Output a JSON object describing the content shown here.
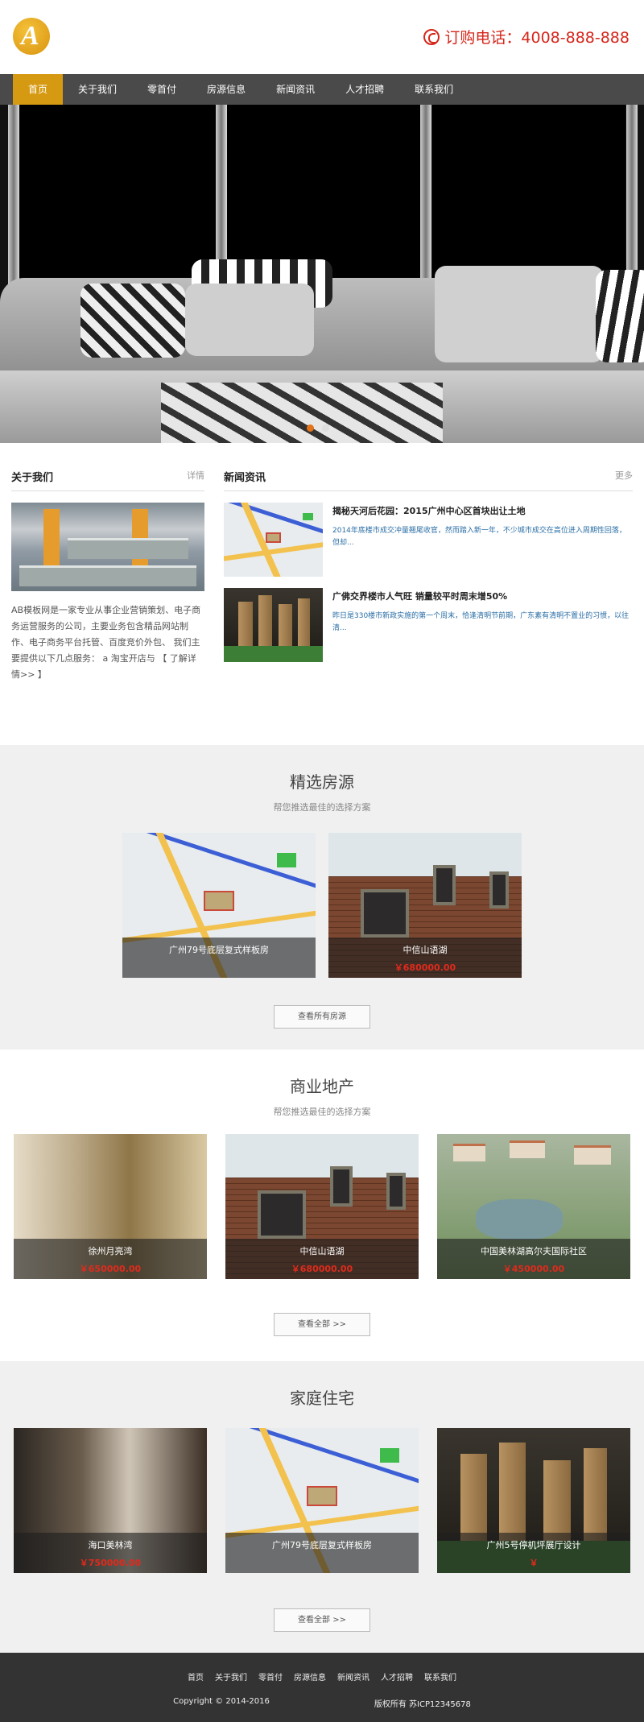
{
  "header": {
    "logo_letter": "A",
    "hotline": "订购电话：4008-888-888"
  },
  "nav": [
    "首页",
    "关于我们",
    "零首付",
    "房源信息",
    "新闻资讯",
    "人才招聘",
    "联系我们"
  ],
  "about": {
    "title": "关于我们",
    "more": "详情",
    "text": "AB模板网是一家专业从事企业营销策划、电子商务运营服务的公司，主要业务包含精品网站制作、电子商务平台托管、百度竞价外包、 我们主要提供以下几点服务： a 淘宝开店与 【 了解详情>> 】"
  },
  "news": {
    "title": "新闻资讯",
    "more": "更多",
    "items": [
      {
        "title": "揭秘天河后花园：2015广州中心区首块出让土地",
        "desc": "2014年底楼市成交冲量翘尾收官，然而踏入新一年，不少城市成交在高位进入周期性回落，但却..."
      },
      {
        "title": "广佛交界楼市人气旺 销量较平时周末增50%",
        "desc": "昨日是330楼市新政实施的第一个周末，恰逢清明节前期，广东素有清明不置业的习惯，以往清..."
      }
    ]
  },
  "featured": {
    "title": "精选房源",
    "subtitle": "帮您推选最佳的选择方案",
    "items": [
      {
        "name": "广州79号底层复式样板房",
        "price": ""
      },
      {
        "name": "中信山语湖",
        "price": "￥680000.00"
      }
    ],
    "button": "查看所有房源"
  },
  "commercial": {
    "title": "商业地产",
    "subtitle": "帮您推选最佳的选择方案",
    "items": [
      {
        "name": "徐州月亮湾",
        "price": "￥650000.00"
      },
      {
        "name": "中信山语湖",
        "price": "￥680000.00"
      },
      {
        "name": "中国美林湖高尔夫国际社区",
        "price": "￥450000.00"
      }
    ],
    "button": "查看全部 >>"
  },
  "home": {
    "title": "家庭住宅",
    "items": [
      {
        "name": "海口美林湾",
        "price": "￥750000.00"
      },
      {
        "name": "广州79号底层复式样板房",
        "price": ""
      },
      {
        "name": "广州5号停机坪展厅设计",
        "price": "￥"
      }
    ],
    "button": "查看全部 >>"
  },
  "footer": {
    "nav": [
      "首页",
      "关于我们",
      "零首付",
      "房源信息",
      "新闻资讯",
      "人才招聘",
      "联系我们"
    ],
    "copyright": "Copyright © 2014-2016",
    "icp": "版权所有 苏ICP12345678"
  }
}
